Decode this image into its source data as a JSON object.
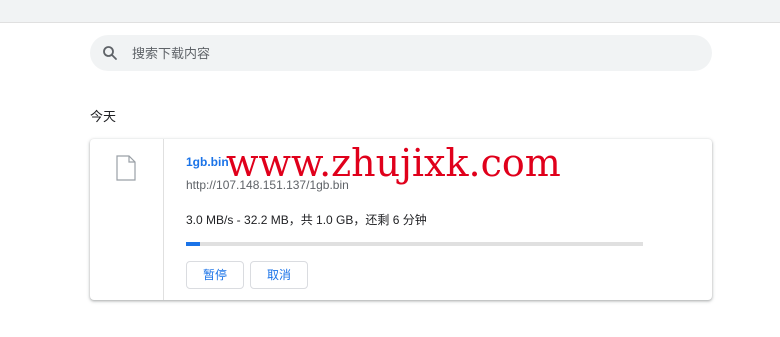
{
  "search": {
    "placeholder": "搜索下载内容",
    "icon": "search-icon"
  },
  "section": {
    "label": "今天"
  },
  "download": {
    "filename": "1gb.bin",
    "url": "http://107.148.151.137/1gb.bin",
    "status": "3.0 MB/s - 32.2 MB，共 1.0 GB，还剩 6 分钟",
    "progress": 0.03,
    "file_icon": "file-icon",
    "pause_label": "暂停",
    "cancel_label": "取消"
  },
  "watermark": {
    "text": "www.zhujixk.com"
  },
  "colors": {
    "accent": "#1a73e8",
    "watermark": "#e0001b"
  }
}
